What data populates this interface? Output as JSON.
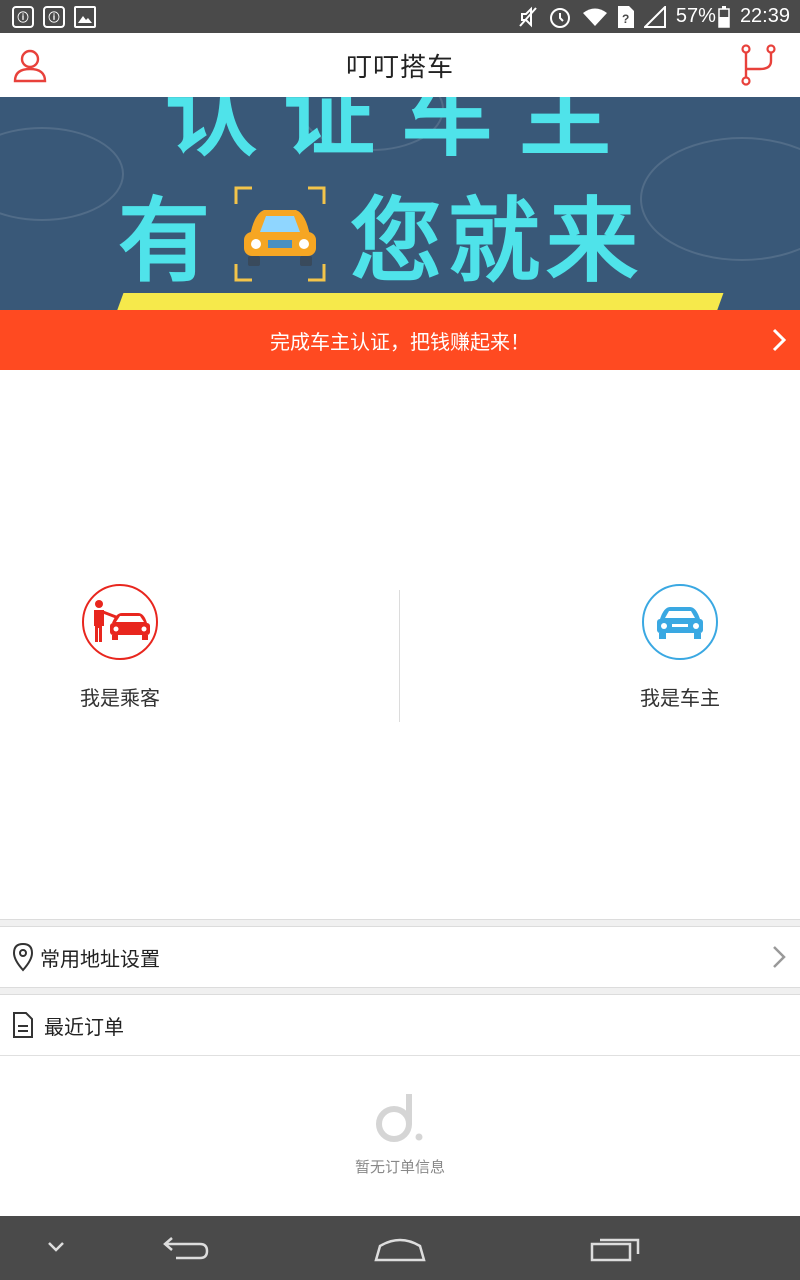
{
  "status_bar": {
    "battery": "57%",
    "time": "22:39",
    "left_icons": [
      "notification-icon",
      "notification-icon",
      "image-icon"
    ],
    "right_icons": [
      "mute-icon",
      "alarm-icon",
      "wifi-icon",
      "sim-icon",
      "signal-icon",
      "battery-icon"
    ]
  },
  "header": {
    "title": "叮叮搭车",
    "left_icon": "user-icon",
    "right_icon": "route-icon"
  },
  "banner": {
    "line1": "认证车主",
    "line2_left": "有",
    "line2_right": "您就来",
    "background": "#395878",
    "text_color": "#4fe3ea"
  },
  "promo": {
    "text": "完成车主认证，把钱赚起来！",
    "color": "#ff4a21"
  },
  "roles": {
    "passenger": {
      "label": "我是乘客",
      "color": "#e8261e",
      "icon": "passenger-car-icon"
    },
    "driver": {
      "label": "我是车主",
      "color": "#3aa8e2",
      "icon": "car-icon"
    }
  },
  "address_row": {
    "label": "常用地址设置",
    "icon": "location-pin-icon"
  },
  "orders_row": {
    "label": "最近订单",
    "icon": "document-icon"
  },
  "empty_state": {
    "text": "暂无订单信息",
    "icon": "empty-logo-icon"
  },
  "nav_bar": {
    "icons": [
      "collapse-icon",
      "back-icon",
      "home-icon",
      "recents-icon"
    ]
  }
}
